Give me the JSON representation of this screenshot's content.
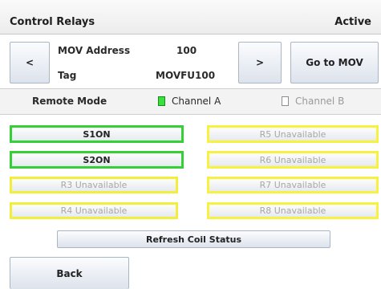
{
  "header": {
    "title": "Control Relays",
    "status": "Active"
  },
  "nav": {
    "prev_label": "<",
    "next_label": ">",
    "goto_label": "Go to MOV"
  },
  "mov": {
    "address_label": "MOV Address",
    "address_value": "100",
    "tag_label": "Tag",
    "tag_value": "MOVFU100"
  },
  "mode": {
    "label": "Remote Mode",
    "channel_a": "Channel A",
    "channel_b": "Channel B"
  },
  "relays": [
    {
      "label": "S1ON",
      "state": "active"
    },
    {
      "label": "S2ON",
      "state": "active"
    },
    {
      "label": "R3 Unavailable",
      "state": "unavailable"
    },
    {
      "label": "R4 Unavailable",
      "state": "unavailable"
    },
    {
      "label": "R5 Unavailable",
      "state": "unavailable"
    },
    {
      "label": "R6 Unavailable",
      "state": "unavailable"
    },
    {
      "label": "R7 Unavailable",
      "state": "unavailable"
    },
    {
      "label": "R8 Unavailable",
      "state": "unavailable"
    }
  ],
  "refresh_label": "Refresh Coil Status",
  "back_label": "Back",
  "colors": {
    "active_border": "#35d035",
    "unavailable_border": "#f2ee3c",
    "channel_a_indicator": "#39e13c"
  }
}
